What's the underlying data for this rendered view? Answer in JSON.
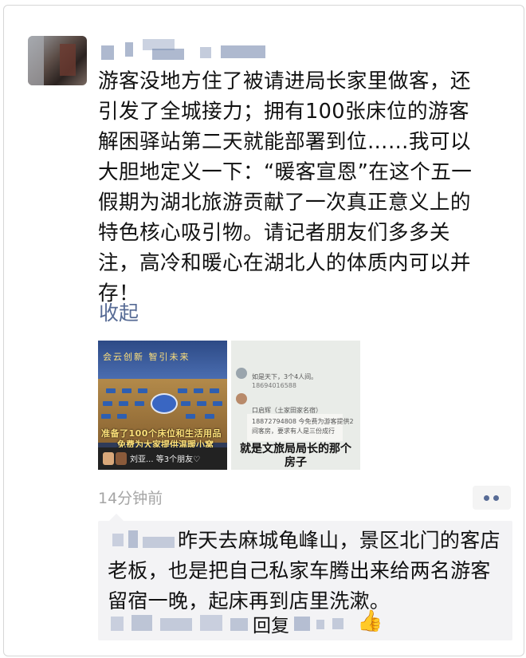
{
  "post": {
    "text": "游客没地方住了被请进局长家里做客，还\n引发了全城接力；拥有100张床位的游客\n解困驿站第二天就能部署到位……我可以\n大胆地定义一下：“暖客宣恩”在这个五一\n假期为湖北旅游贡献了一次真正意义上的\n特色核心吸引物。请记者朋友们多多关\n注，高冷和暖心在湖北人的体质内可以并\n存！",
    "collapse_label": "收起",
    "time": "14分钟前"
  },
  "images": [
    {
      "banner": "会云创新  智引未来",
      "caption_line1": "准备了100个床位和生活用品",
      "caption_line2": "免费为大家提供温暖小窝",
      "bottom_text": "刘亚... 等3个朋友♡"
    },
    {
      "line1": "如是天下，3个4人间。",
      "line2": "18694016588",
      "line3": "口启辉（土家田家名宿）",
      "line4": "18872794808 今免费为游客提供2",
      "line5": "间客房，要求有人是三份成行",
      "caption": "就是文旅局局长的那个\n房子"
    }
  ],
  "comment": {
    "text": "昨天去麻城龟峰山，景区北门的客店老板，也是把自己私家车腾出来给两名游客留宿一晚，起床再到店里洗漱。",
    "reply_label": "回复",
    "like_icon": "thumbs-up-icon"
  },
  "colors": {
    "link": "#576b95",
    "time": "#a5a5a5",
    "comment_bg": "#f3f3f5"
  }
}
